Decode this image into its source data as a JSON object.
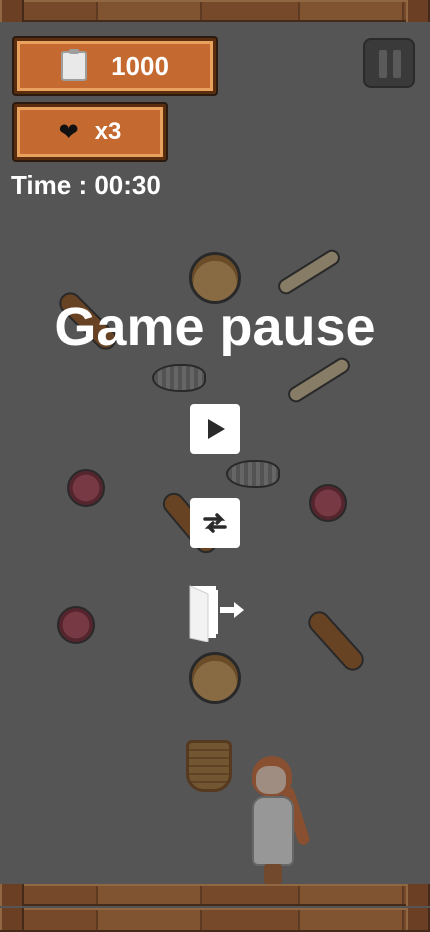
{
  "hud": {
    "score": "1000",
    "lives": "x3",
    "time_label": "Time : 00:30"
  },
  "pause_menu": {
    "title": "Game pause"
  },
  "icons": {
    "score": "clipboard-icon",
    "lives": "heart-icon",
    "pause": "pause-icon",
    "resume": "play-icon",
    "restart": "swap-arrows-icon",
    "exit": "exit-door-icon"
  },
  "colors": {
    "background": "#5a5a5a",
    "plaque_wood": "#c4692f",
    "text": "#ffffff"
  }
}
